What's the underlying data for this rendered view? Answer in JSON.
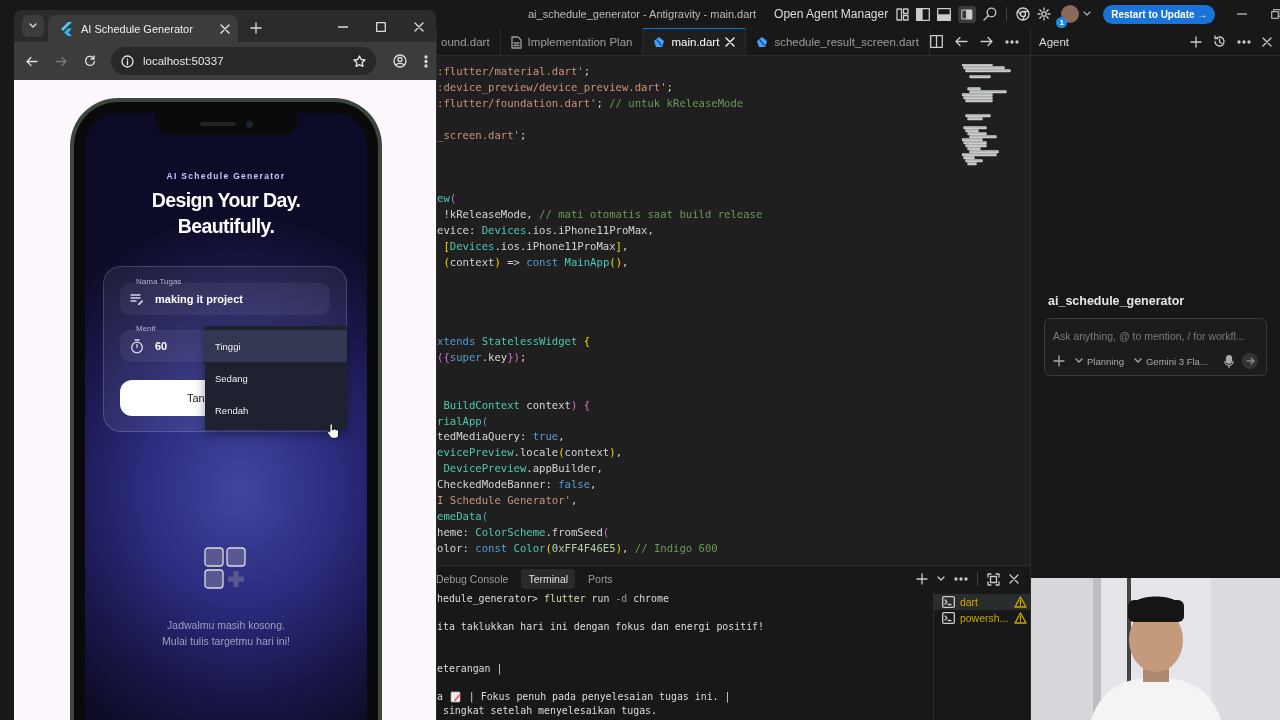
{
  "ide": {
    "title": "ai_schedule_generator - Antigravity - main.dart",
    "agent_manager": "Open Agent Manager",
    "notification_count": "1",
    "update_button": "Restart to Update →"
  },
  "editor_tabs": [
    {
      "label": "ound.dart",
      "kind": "cut",
      "selected": false
    },
    {
      "label": "Implementation Plan",
      "kind": "doc",
      "selected": false
    },
    {
      "label": "main.dart",
      "kind": "dart",
      "selected": true
    },
    {
      "label": "schedule_result_screen.dart",
      "kind": "dart",
      "selected": false
    }
  ],
  "code_lines": [
    {
      "kind": "code",
      "tokens": [
        {
          "kind": "str",
          "text": ":flutter/material.dart'"
        },
        {
          "kind": "plain",
          "text": ";"
        }
      ]
    },
    {
      "kind": "code",
      "tokens": [
        {
          "kind": "str",
          "text": ":device_preview/device_preview.dart'"
        },
        {
          "kind": "plain",
          "text": ";"
        }
      ]
    },
    {
      "kind": "code",
      "tokens": [
        {
          "kind": "str",
          "text": ":flutter/foundation.dart'"
        },
        {
          "kind": "plain",
          "text": "; "
        },
        {
          "kind": "com",
          "text": "// untuk kReleaseMode"
        }
      ]
    },
    {
      "kind": "blank"
    },
    {
      "kind": "code",
      "tokens": [
        {
          "kind": "str",
          "text": "_screen.dart'"
        },
        {
          "kind": "plain",
          "text": ";"
        }
      ]
    },
    {
      "kind": "blank"
    },
    {
      "kind": "blank"
    },
    {
      "kind": "blank"
    },
    {
      "kind": "code",
      "tokens": [
        {
          "kind": "type",
          "text": "ew"
        },
        {
          "kind": "punct2",
          "text": "("
        }
      ]
    },
    {
      "kind": "code",
      "tokens": [
        {
          "kind": "plain",
          "text": " !kReleaseMode, "
        },
        {
          "kind": "com",
          "text": "// mati otomatis saat build release"
        }
      ]
    },
    {
      "kind": "code",
      "tokens": [
        {
          "kind": "plain",
          "text": "evice: "
        },
        {
          "kind": "type",
          "text": "Devices"
        },
        {
          "kind": "plain",
          "text": ".ios.iPhone11ProMax,"
        }
      ]
    },
    {
      "kind": "code",
      "tokens": [
        {
          "kind": "punct",
          "text": " ["
        },
        {
          "kind": "type",
          "text": "Devices"
        },
        {
          "kind": "plain",
          "text": ".ios.iPhone11ProMax"
        },
        {
          "kind": "punct",
          "text": "]"
        },
        {
          "kind": "plain",
          "text": ","
        }
      ]
    },
    {
      "kind": "code",
      "tokens": [
        {
          "kind": "punct",
          "text": " ("
        },
        {
          "kind": "plain",
          "text": "context"
        },
        {
          "kind": "punct",
          "text": ")"
        },
        {
          "kind": "plain",
          "text": " => "
        },
        {
          "kind": "kw",
          "text": "const "
        },
        {
          "kind": "type",
          "text": "MainApp"
        },
        {
          "kind": "punct",
          "text": "()"
        },
        {
          "kind": "plain",
          "text": ","
        }
      ]
    },
    {
      "kind": "blank"
    },
    {
      "kind": "blank"
    },
    {
      "kind": "blank"
    },
    {
      "kind": "blank"
    },
    {
      "kind": "code",
      "tokens": [
        {
          "kind": "kw",
          "text": "xtends "
        },
        {
          "kind": "type",
          "text": "StatelessWidget "
        },
        {
          "kind": "punct",
          "text": "{"
        }
      ]
    },
    {
      "kind": "code",
      "tokens": [
        {
          "kind": "punct2",
          "text": "({"
        },
        {
          "kind": "kw",
          "text": "super"
        },
        {
          "kind": "plain",
          "text": ".key"
        },
        {
          "kind": "punct2",
          "text": "})"
        },
        {
          "kind": "plain",
          "text": ";"
        }
      ]
    },
    {
      "kind": "blank"
    },
    {
      "kind": "blank"
    },
    {
      "kind": "code",
      "tokens": [
        {
          "kind": "type",
          "text": " BuildContext "
        },
        {
          "kind": "plain",
          "text": "context"
        },
        {
          "kind": "punct2",
          "text": ") {"
        }
      ]
    },
    {
      "kind": "code",
      "tokens": [
        {
          "kind": "type",
          "text": "rialApp"
        },
        {
          "kind": "kw",
          "text": "("
        }
      ]
    },
    {
      "kind": "code",
      "tokens": [
        {
          "kind": "plain",
          "text": "tedMediaQuery: "
        },
        {
          "kind": "kw",
          "text": "true"
        },
        {
          "kind": "plain",
          "text": ","
        }
      ]
    },
    {
      "kind": "code",
      "tokens": [
        {
          "kind": "type",
          "text": "evicePreview"
        },
        {
          "kind": "plain",
          "text": ".locale"
        },
        {
          "kind": "punct",
          "text": "("
        },
        {
          "kind": "plain",
          "text": "context"
        },
        {
          "kind": "punct",
          "text": ")"
        },
        {
          "kind": "plain",
          "text": ","
        }
      ]
    },
    {
      "kind": "code",
      "tokens": [
        {
          "kind": "type",
          "text": " DevicePreview"
        },
        {
          "kind": "plain",
          "text": ".appBuilder,"
        }
      ]
    },
    {
      "kind": "code",
      "tokens": [
        {
          "kind": "plain",
          "text": "CheckedModeBanner: "
        },
        {
          "kind": "kw",
          "text": "false"
        },
        {
          "kind": "plain",
          "text": ","
        }
      ]
    },
    {
      "kind": "code",
      "tokens": [
        {
          "kind": "str",
          "text": "I Schedule Generator'"
        },
        {
          "kind": "plain",
          "text": ","
        }
      ]
    },
    {
      "kind": "code",
      "tokens": [
        {
          "kind": "type",
          "text": "emeData"
        },
        {
          "kind": "kw",
          "text": "("
        }
      ]
    },
    {
      "kind": "code",
      "tokens": [
        {
          "kind": "plain",
          "text": "heme: "
        },
        {
          "kind": "type",
          "text": "ColorScheme"
        },
        {
          "kind": "plain",
          "text": ".fromSeed"
        },
        {
          "kind": "punct2",
          "text": "("
        }
      ]
    },
    {
      "kind": "code",
      "tokens": [
        {
          "kind": "plain",
          "text": "olor: "
        },
        {
          "kind": "kw",
          "text": "const "
        },
        {
          "kind": "type",
          "text": "Color"
        },
        {
          "kind": "punct",
          "text": "("
        },
        {
          "kind": "num",
          "text": "0xFF4F46E5"
        },
        {
          "kind": "punct",
          "text": ")"
        },
        {
          "kind": "plain",
          "text": ", "
        },
        {
          "kind": "com",
          "text": "// Indigo 600"
        }
      ]
    }
  ],
  "panel": {
    "tabs": [
      {
        "label": "Debug Console",
        "selected": false
      },
      {
        "label": "Terminal",
        "selected": true
      },
      {
        "label": "Ports",
        "selected": false
      }
    ],
    "terminal_lines": [
      {
        "kind": "code",
        "tokens": [
          {
            "kind": "plain",
            "text": "hedule_generator> "
          },
          {
            "kind": "cmd",
            "text": "flutter"
          },
          {
            "kind": "plain",
            "text": " run "
          },
          {
            "kind": "flag",
            "text": "-d"
          },
          {
            "kind": "plain",
            "text": " chrome"
          }
        ]
      },
      {
        "kind": "blank"
      },
      {
        "kind": "code",
        "tokens": [
          {
            "kind": "plain",
            "text": "ita taklukkan hari ini dengan fokus dan energi positif!"
          }
        ]
      },
      {
        "kind": "blank"
      },
      {
        "kind": "blank"
      },
      {
        "kind": "code",
        "tokens": [
          {
            "kind": "plain",
            "text": "eterangan |"
          }
        ]
      },
      {
        "kind": "blank"
      },
      {
        "kind": "code",
        "tokens": [
          {
            "kind": "plain",
            "text": "a "
          },
          {
            "kind": "icon"
          },
          {
            "kind": "plain",
            "text": " | Fokus penuh pada penyelesaian tugas ini. |"
          }
        ]
      },
      {
        "kind": "code",
        "tokens": [
          {
            "kind": "plain",
            "text": " singkat setelah menyelesaikan tugas."
          }
        ]
      }
    ],
    "terminals": [
      {
        "label": "dart",
        "selected": true
      },
      {
        "label": "powersh...",
        "selected": false
      }
    ]
  },
  "agent": {
    "title": "Agent",
    "workspace": "ai_schedule_generator",
    "placeholder": "Ask anything, @ to mention, / for workfl...",
    "mode": "Planning",
    "model": "Gemini 3 Fla..."
  },
  "browser": {
    "tab_title": "AI Schedule Generator",
    "url": "localhost:50337",
    "nav": [
      {
        "kind": "back",
        "disabled": false
      },
      {
        "kind": "forward",
        "disabled": true
      },
      {
        "kind": "reload",
        "disabled": false
      }
    ]
  },
  "app": {
    "eyebrow": "AI Schedule Generator",
    "heading": [
      "Design Your Day.",
      "Beautifully."
    ],
    "task_label": "Nama Tugas",
    "task_value": "making it project",
    "minutes_label": "Menit",
    "minutes_value": "60",
    "button": "Tan",
    "priority_options": [
      {
        "label": "Tinggi",
        "selected": true
      },
      {
        "label": "Sedang",
        "selected": false
      },
      {
        "label": "Rendah",
        "selected": false
      }
    ],
    "empty_state": [
      "Jadwalmu masih kosong.",
      "Mulai tulis targetmu hari ini!"
    ]
  }
}
